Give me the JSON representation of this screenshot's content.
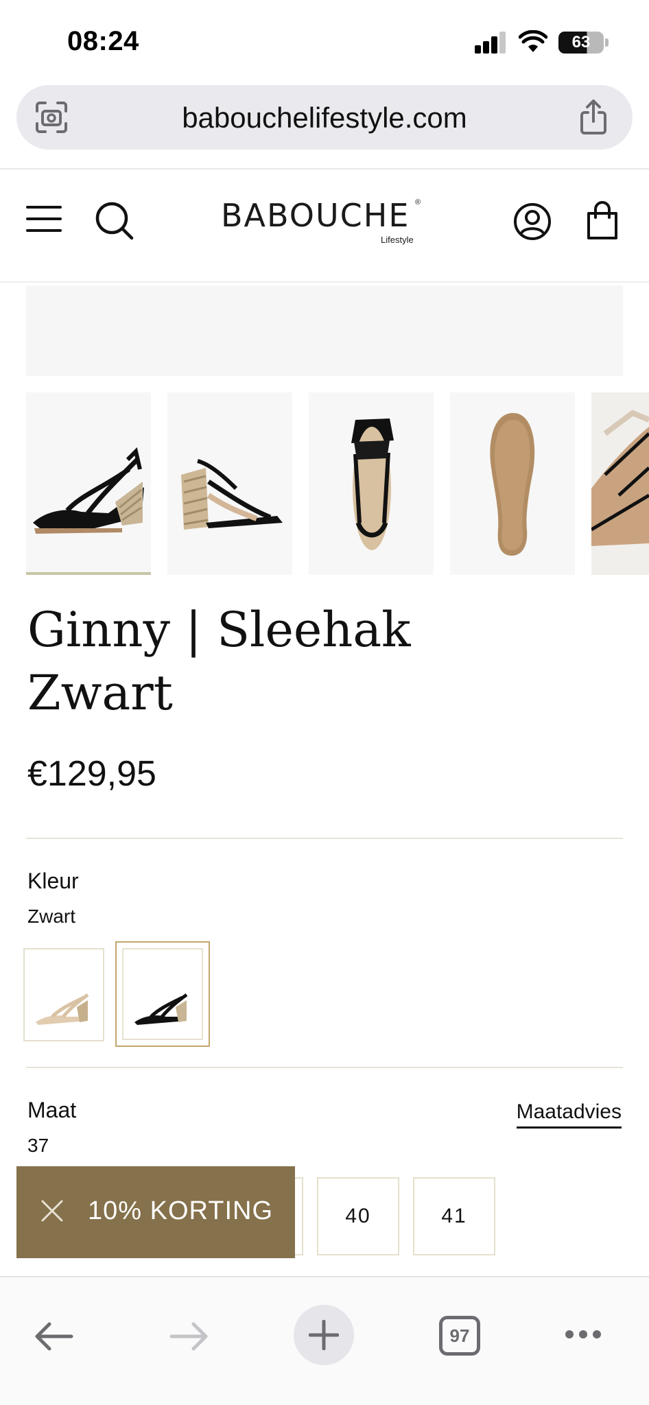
{
  "status_bar": {
    "time": "08:24",
    "battery": "63"
  },
  "browser": {
    "url": "babouchelifestyle.com",
    "tab_count": "97"
  },
  "site": {
    "logo": "BABOUCHE",
    "logo_sub": "Lifestyle",
    "logo_reg": "®"
  },
  "product": {
    "title_line1": "Ginny | Sleehak",
    "title_line2": "Zwart",
    "price": "€129,95",
    "color_label": "Kleur",
    "color_value": "Zwart",
    "size_label": "Maat",
    "size_value": "37",
    "size_advice": "Maatadvies",
    "sizes": [
      "40",
      "41"
    ]
  },
  "promo": {
    "label": "10% KORTING"
  },
  "colors": {
    "accent": "#85714b",
    "swatch_border": "#c2a56b",
    "divider": "#e7e3d4"
  },
  "icons": {
    "url_left": "camera-scan-icon",
    "url_right": "share-icon",
    "menu": "hamburger-menu-icon",
    "search": "search-icon",
    "account": "user-icon",
    "cart": "shopping-bag-icon",
    "back": "arrow-left-icon",
    "forward": "arrow-right-icon",
    "new_tab": "plus-icon",
    "more": "ellipsis-icon"
  }
}
